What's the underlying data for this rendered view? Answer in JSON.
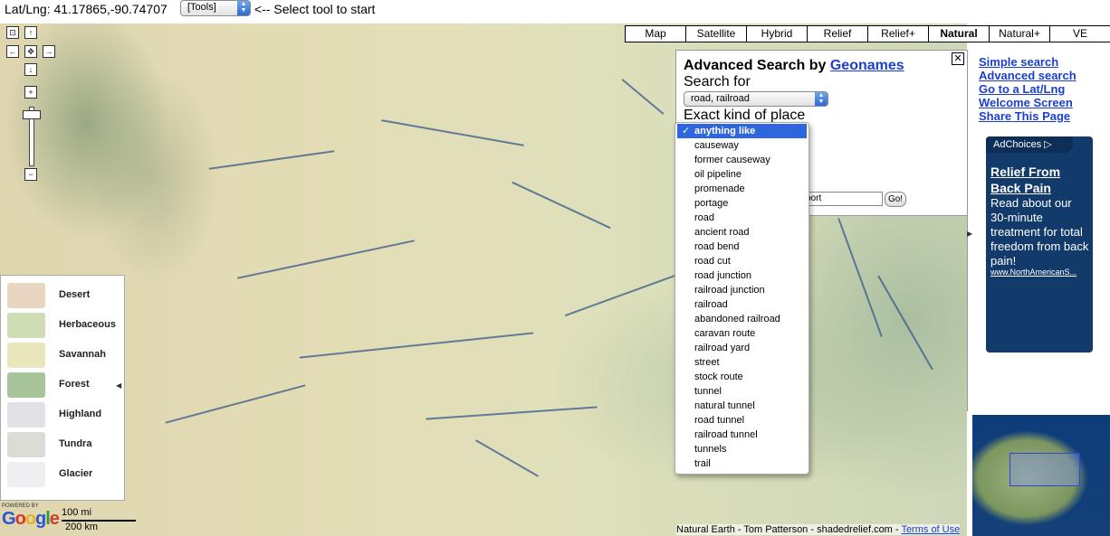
{
  "topbar": {
    "latlng": "Lat/Lng: 41.17865,-90.74707",
    "tools_label": "[Tools]",
    "hint": "<-- Select tool to start"
  },
  "map_types": [
    "Map",
    "Satellite",
    "Hybrid",
    "Relief",
    "Relief+",
    "Natural",
    "Natural+",
    "VE"
  ],
  "map_type_active": "Natural",
  "zoom": {
    "in_label": "+",
    "out_label": "−"
  },
  "legend": [
    {
      "label": "Desert",
      "color": "#e8d6c0"
    },
    {
      "label": "Herbaceous",
      "color": "#cfdcb6"
    },
    {
      "label": "Savannah",
      "color": "#e7e7bb"
    },
    {
      "label": "Forest",
      "color": "#a7c49b"
    },
    {
      "label": "Highland",
      "color": "#e1e1e6"
    },
    {
      "label": "Tundra",
      "color": "#dcdcd7"
    },
    {
      "label": "Glacier",
      "color": "#efeff2"
    }
  ],
  "search": {
    "title_prefix": "Advanced Search by",
    "title_link": "Geonames",
    "search_for_label": "Search for",
    "kind_select_value": "road, railroad",
    "exact_label": "Exact kind of place",
    "near_value": "port",
    "go_label": "Go!",
    "close_label": "✕"
  },
  "dropdown": {
    "checkmark": "✓",
    "selected": "anything like",
    "options": [
      "anything like",
      "causeway",
      "former causeway",
      "oil pipeline",
      "promenade",
      "portage",
      "road",
      "ancient road",
      "road bend",
      "road cut",
      "road junction",
      "railroad junction",
      "railroad",
      "abandoned railroad",
      "caravan route",
      "railroad yard",
      "street",
      "stock route",
      "tunnel",
      "natural tunnel",
      "road tunnel",
      "railroad tunnel",
      "tunnels",
      "trail"
    ]
  },
  "right_links": [
    "Simple search",
    "Advanced search",
    "Go to a Lat/Lng",
    "Welcome Screen",
    "Share This Page"
  ],
  "ad": {
    "choices": "AdChoices ▷",
    "title": "Relief From Back Pain",
    "body": "Read about our 30-minute treatment for total freedom from back pain!",
    "url": "www.NorthAmericanS..."
  },
  "footer": {
    "attribution": "Natural Earth - Tom Patterson - shadedrelief.com - ",
    "terms": "Terms of Use",
    "powered_by": "POWERED BY",
    "google": "Google",
    "scale_top": "100 mi",
    "scale_bottom": "200 km"
  }
}
